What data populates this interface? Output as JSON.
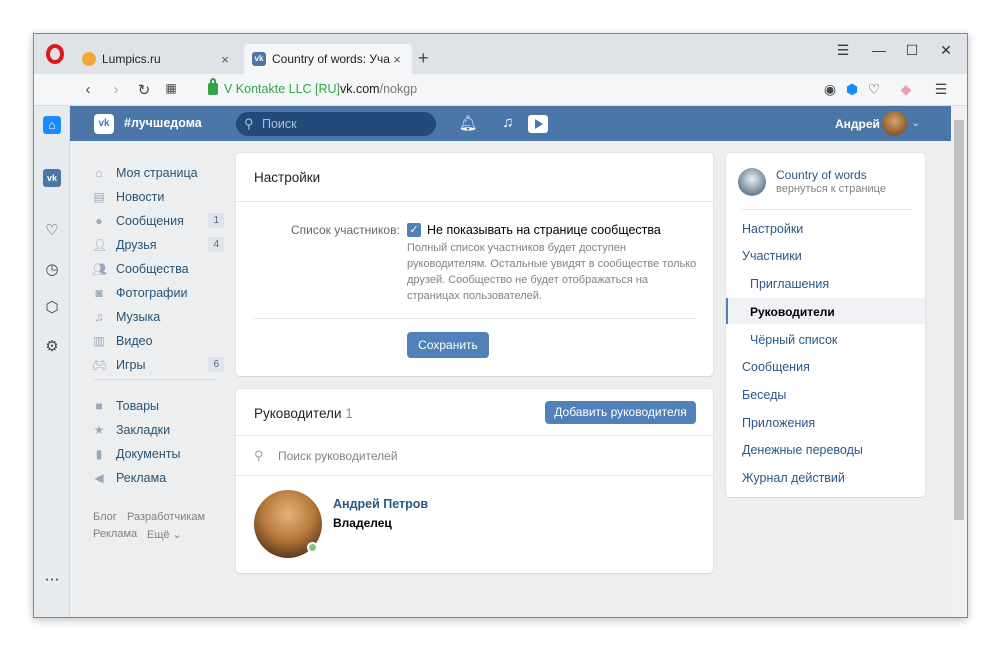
{
  "browser": {
    "tabs": [
      {
        "title": "Lumpics.ru",
        "close": "×"
      },
      {
        "title": "Country of words: Участники",
        "close": "×"
      }
    ],
    "new_tab": "+",
    "address": {
      "cert": "V Kontakte LLC [RU]",
      "domain": "vk.com",
      "path": "/nokgp"
    }
  },
  "vk": {
    "title": "#лучшедома",
    "search_placeholder": "Поиск",
    "username": "Андрей",
    "menu": [
      {
        "label": "Моя страница",
        "count": ""
      },
      {
        "label": "Новости",
        "count": ""
      },
      {
        "label": "Сообщения",
        "count": "1"
      },
      {
        "label": "Друзья",
        "count": "4"
      },
      {
        "label": "Сообщества",
        "count": ""
      },
      {
        "label": "Фотографии",
        "count": ""
      },
      {
        "label": "Музыка",
        "count": ""
      },
      {
        "label": "Видео",
        "count": ""
      },
      {
        "label": "Игры",
        "count": "6"
      }
    ],
    "menu2": [
      {
        "label": "Товары"
      },
      {
        "label": "Закладки"
      },
      {
        "label": "Документы"
      },
      {
        "label": "Реклама"
      }
    ],
    "footer": {
      "blog": "Блог",
      "dev": "Разработчикам",
      "ads": "Реклама",
      "more": "Ещё ⌄"
    }
  },
  "settings": {
    "title": "Настройки",
    "members_label": "Список участников:",
    "checkbox_label": "Не показывать на странице сообщества",
    "hint": "Полный список участников будет доступен руководителям. Остальные увидят в сообществе только друзей. Сообщество не будет отображаться на страницах пользователей.",
    "save": "Сохранить"
  },
  "managers": {
    "title": "Руководители",
    "count": "1",
    "add": "Добавить руководителя",
    "search_placeholder": "Поиск руководителей",
    "person": {
      "name": "Андрей Петров",
      "role": "Владелец"
    }
  },
  "right_panel": {
    "group_name": "Country of words",
    "back": "вернуться к странице",
    "items": [
      {
        "label": "Настройки"
      },
      {
        "label": "Участники"
      },
      {
        "label": "Приглашения"
      },
      {
        "label": "Руководители"
      },
      {
        "label": "Чёрный список"
      },
      {
        "label": "Сообщения"
      },
      {
        "label": "Беседы"
      },
      {
        "label": "Приложения"
      },
      {
        "label": "Денежные переводы"
      },
      {
        "label": "Журнал действий"
      }
    ]
  },
  "colors": {
    "vk_blue": "#4a76a8",
    "button": "#5181b8",
    "link": "#2a5885"
  }
}
